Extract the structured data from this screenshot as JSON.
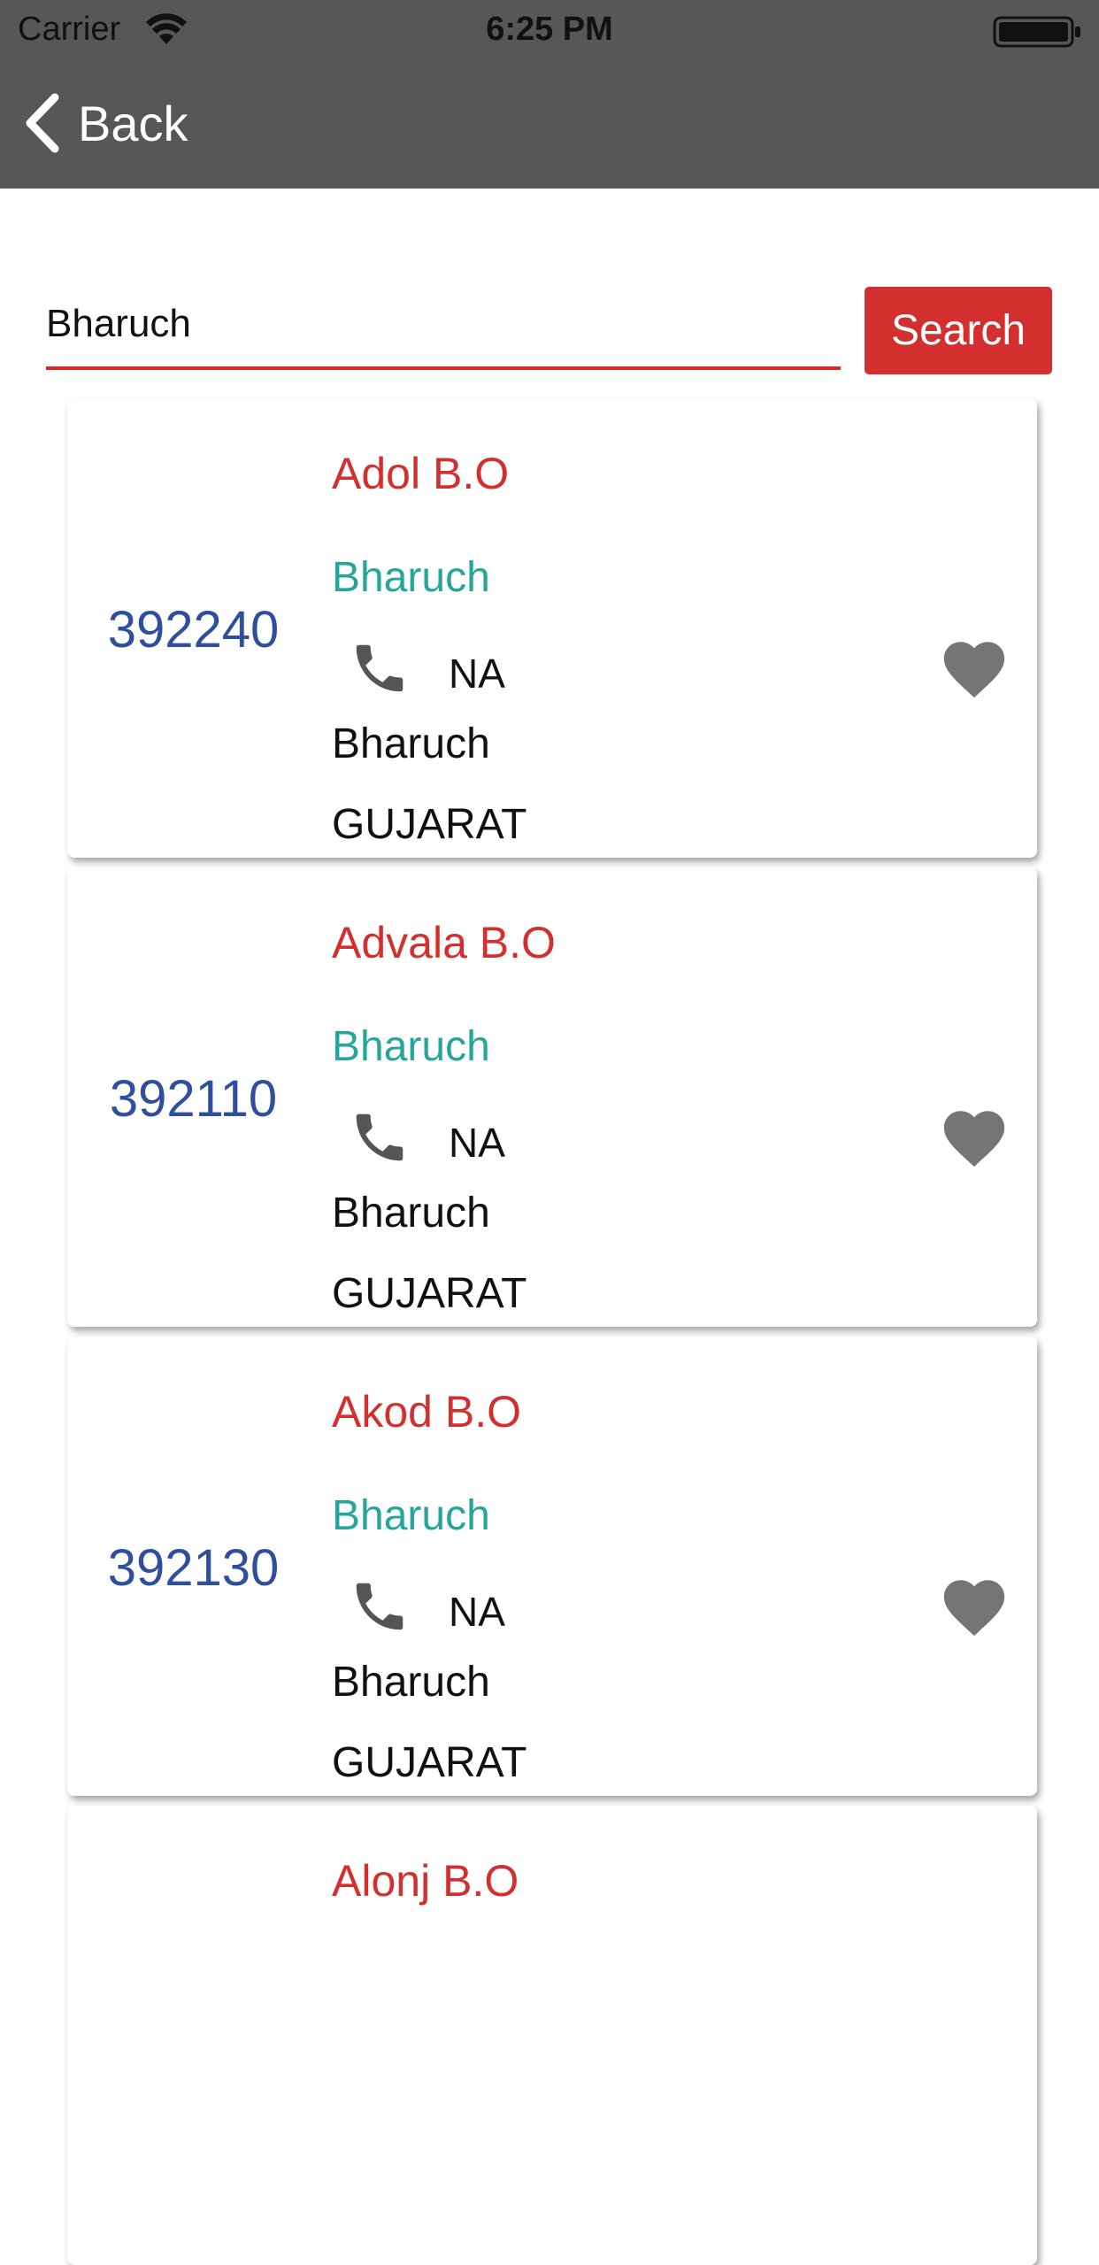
{
  "status_bar": {
    "carrier": "Carrier",
    "time": "6:25 PM"
  },
  "nav": {
    "back_label": "Back"
  },
  "search": {
    "value": "Bharuch",
    "button_label": "Search"
  },
  "results": [
    {
      "pincode": "392240",
      "office": "Adol B.O",
      "district": "Bharuch",
      "phone": "NA",
      "taluk": "Bharuch",
      "state": "GUJARAT"
    },
    {
      "pincode": "392110",
      "office": "Advala B.O",
      "district": "Bharuch",
      "phone": "NA",
      "taluk": "Bharuch",
      "state": "GUJARAT"
    },
    {
      "pincode": "392130",
      "office": "Akod B.O",
      "district": "Bharuch",
      "phone": "NA",
      "taluk": "Bharuch",
      "state": "GUJARAT"
    },
    {
      "pincode": "",
      "office": "Alonj B.O",
      "district": "",
      "phone": "",
      "taluk": "",
      "state": ""
    }
  ],
  "icons": {
    "back": "chevron-left-icon",
    "phone": "phone-icon",
    "favorite": "heart-icon",
    "wifi": "wifi-icon",
    "battery": "battery-icon"
  },
  "colors": {
    "bar": "#575757",
    "accent": "#d32f2f",
    "pincode": "#2f4f9e",
    "district": "#26a69a",
    "heart": "#757575"
  }
}
